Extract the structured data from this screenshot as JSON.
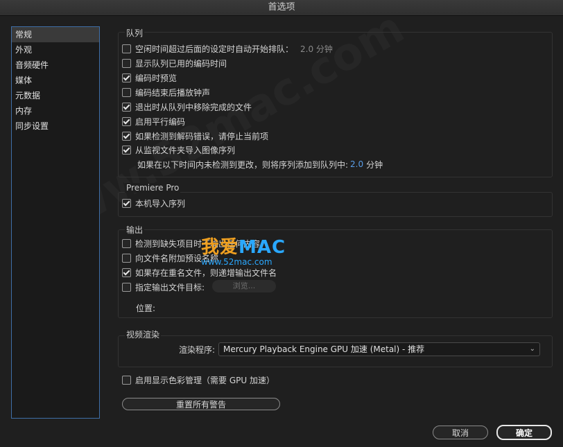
{
  "window": {
    "title": "首选项"
  },
  "sidebar": {
    "items": [
      {
        "label": "常规",
        "selected": true
      },
      {
        "label": "外观"
      },
      {
        "label": "音频硬件"
      },
      {
        "label": "媒体"
      },
      {
        "label": "元数据"
      },
      {
        "label": "内存"
      },
      {
        "label": "同步设置"
      }
    ]
  },
  "queue": {
    "title": "队列",
    "items": [
      {
        "label": "空闲时间超过后面的设定时自动开始排队：",
        "checked": false,
        "value": "2.0 分钟"
      },
      {
        "label": "显示队列已用的编码时间",
        "checked": false
      },
      {
        "label": "编码时预览",
        "checked": true
      },
      {
        "label": "编码结束后播放钟声",
        "checked": false
      },
      {
        "label": "退出时从队列中移除完成的文件",
        "checked": true
      },
      {
        "label": "启用平行编码",
        "checked": true
      },
      {
        "label": "如果检测到解码错误，请停止当前项",
        "checked": true
      },
      {
        "label": "从监视文件夹导入图像序列",
        "checked": true
      }
    ],
    "detect_text": "如果在以下时间内未检测到更改，则将序列添加到队列中:",
    "detect_value": "2.0",
    "detect_unit": "分钟"
  },
  "premiere": {
    "title": "Premiere Pro",
    "items": [
      {
        "label": "本机导入序列",
        "checked": true
      }
    ]
  },
  "output": {
    "title": "输出",
    "items": [
      {
        "label": "检测到缺失项目时不输出任何内容",
        "checked": false
      },
      {
        "label": "向文件名附加预设名称",
        "checked": false
      },
      {
        "label": "如果存在重名文件，则递增输出文件名",
        "checked": true
      },
      {
        "label": "指定输出文件目标:",
        "checked": false
      }
    ],
    "browse_label": "浏览...",
    "location_label": "位置:"
  },
  "render": {
    "title": "视频渲染",
    "renderer_label": "渲染程序:",
    "renderer_value": "Mercury Playback Engine GPU 加速 (Metal) - 推荐"
  },
  "color_mgmt": {
    "label": "启用显示色彩管理（需要 GPU 加速）",
    "checked": false
  },
  "reset_warnings_label": "重置所有警告",
  "footer": {
    "cancel_label": "取消",
    "ok_label": "确定"
  },
  "watermark": {
    "brand_a": "我爱",
    "brand_b": "MAC",
    "url": "www.52mac.com",
    "bg": "www.52mac.com"
  },
  "colors": {
    "accent": "#3f6fa8",
    "value_blue": "#5a9ee8",
    "watermark_orange": "#f0a020",
    "watermark_blue": "#2aa8ff"
  }
}
